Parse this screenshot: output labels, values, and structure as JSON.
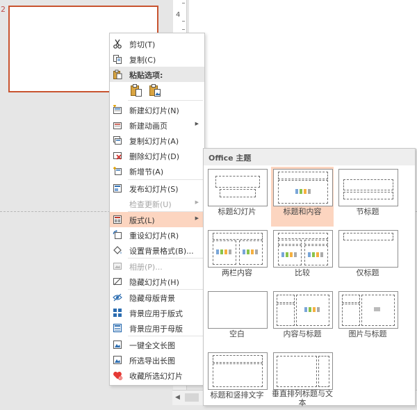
{
  "slide_number": "2",
  "ruler_label": "4",
  "context_menu": {
    "cut": "剪切(T)",
    "copy": "复制(C)",
    "paste_options": "粘贴选项:",
    "new_slide": "新建幻灯片(N)",
    "new_animation_page": "新建动画页",
    "duplicate_slide": "复制幻灯片(A)",
    "delete_slide": "删除幻灯片(D)",
    "add_section": "新增节(A)",
    "publish_slides": "发布幻灯片(S)",
    "check_updates": "检查更新(U)",
    "layout": "版式(L)",
    "reset_slide": "重设幻灯片(R)",
    "format_background": "设置背景格式(B)...",
    "photo_album": "相册(P)...",
    "hide_slide": "隐藏幻灯片(H)",
    "hide_master_background": "隐藏母版背景",
    "apply_background_to_layout": "背景应用于版式",
    "apply_background_to_master": "背景应用于母版",
    "one_click_long_image": "一键全文长图",
    "export_selected_long_image": "所选导出长图",
    "favorite_selected_slides": "收藏所选幻灯片"
  },
  "layout_gallery": {
    "header": "Office 主题",
    "layouts": [
      "标题幻灯片",
      "标题和内容",
      "节标题",
      "两栏内容",
      "比较",
      "仅标题",
      "空白",
      "内容与标题",
      "图片与标题",
      "标题和竖排文字",
      "垂直排列标题与文本"
    ],
    "selected": "标题和内容"
  },
  "colors": {
    "accent": "#c8532f",
    "selection": "#fcd5c0"
  }
}
